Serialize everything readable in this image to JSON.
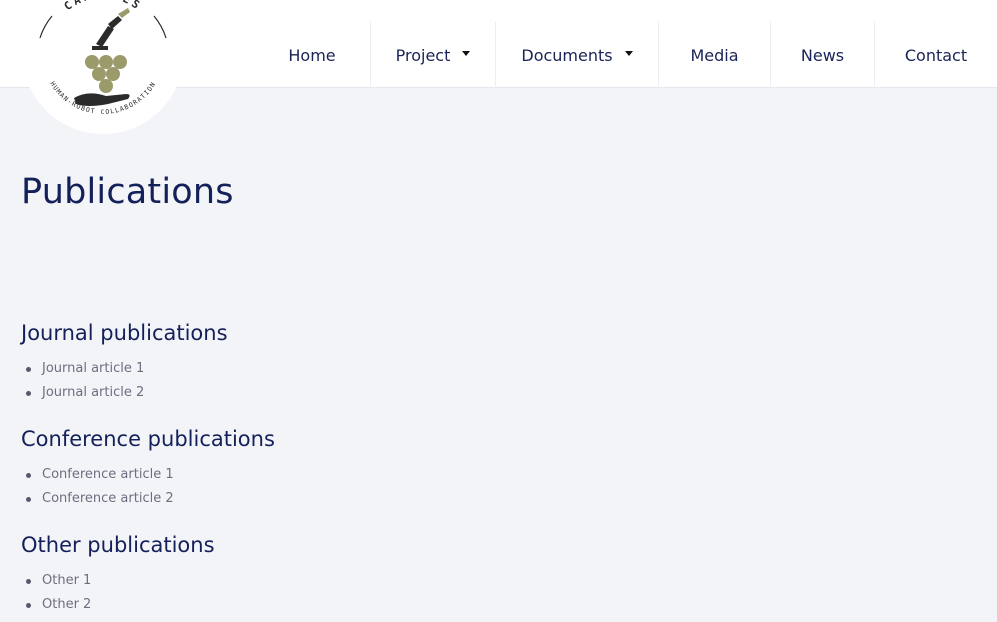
{
  "brand": {
    "name": "CANOPIES",
    "tagline": "HUMAN-ROBOT COLLABORATION",
    "colors": {
      "olive": "#9a9a6a",
      "dark": "#2b2b2b",
      "navy": "#14205a"
    }
  },
  "nav": {
    "items": [
      {
        "label": "Home",
        "dropdown": false
      },
      {
        "label": "Project",
        "dropdown": true
      },
      {
        "label": "Documents",
        "dropdown": true
      },
      {
        "label": "Media",
        "dropdown": false
      },
      {
        "label": "News",
        "dropdown": false
      },
      {
        "label": "Contact",
        "dropdown": false
      }
    ]
  },
  "page": {
    "title": "Publications",
    "sections": [
      {
        "title": "Journal publications",
        "items": [
          "Journal article 1",
          "Journal article 2"
        ]
      },
      {
        "title": "Conference publications",
        "items": [
          "Conference article 1",
          "Conference article 2"
        ]
      },
      {
        "title": "Other publications",
        "items": [
          "Other 1",
          "Other 2"
        ]
      }
    ]
  }
}
